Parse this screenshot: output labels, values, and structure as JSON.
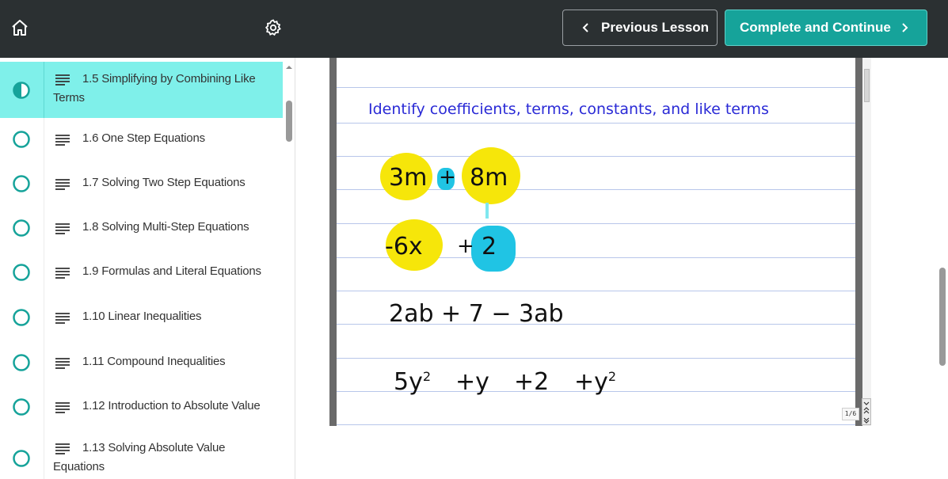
{
  "sidebar": {
    "home_icon": "home-icon",
    "settings_icon": "gear-icon",
    "lessons": [
      {
        "label": "1.5 Simplifying by Combining Like Terms",
        "status": "in-progress",
        "active": true
      },
      {
        "label": "1.6 One Step Equations",
        "status": "not-started"
      },
      {
        "label": "1.7 Solving Two Step Equations",
        "status": "not-started"
      },
      {
        "label": "1.8 Solving Multi-Step Equations",
        "status": "not-started"
      },
      {
        "label": "1.9 Formulas and Literal Equations",
        "status": "not-started"
      },
      {
        "label": "1.10 Linear Inequalities",
        "status": "not-started"
      },
      {
        "label": "1.11 Compound Inequalities",
        "status": "not-started"
      },
      {
        "label": "1.12 Introduction to Absolute Value",
        "status": "not-started"
      },
      {
        "label": "1.13 Solving Absolute Value Equations",
        "status": "not-started"
      }
    ]
  },
  "topbar": {
    "prev_label": "Previous Lesson",
    "next_label": "Complete and Continue"
  },
  "slide": {
    "title": "Identify coefficients, terms, constants, and like terms",
    "line1": {
      "a": "3m",
      "op": "+",
      "b": "8m"
    },
    "line2": {
      "a": "-6x",
      "op": "+",
      "b": "2"
    },
    "line3": "2ab + 7 − 3ab",
    "line4": {
      "t1": "5y",
      "t2": "+y",
      "t3": "+2",
      "t4": "+y"
    },
    "page": "1/6"
  },
  "colors": {
    "header_bg": "#2b3032",
    "accent": "#16a39a",
    "active_lesson_bg": "#7ff0ea",
    "highlight_yellow": "#f6e60a",
    "highlight_cyan": "#20c4e4",
    "title_blue": "#2a2ad6"
  }
}
